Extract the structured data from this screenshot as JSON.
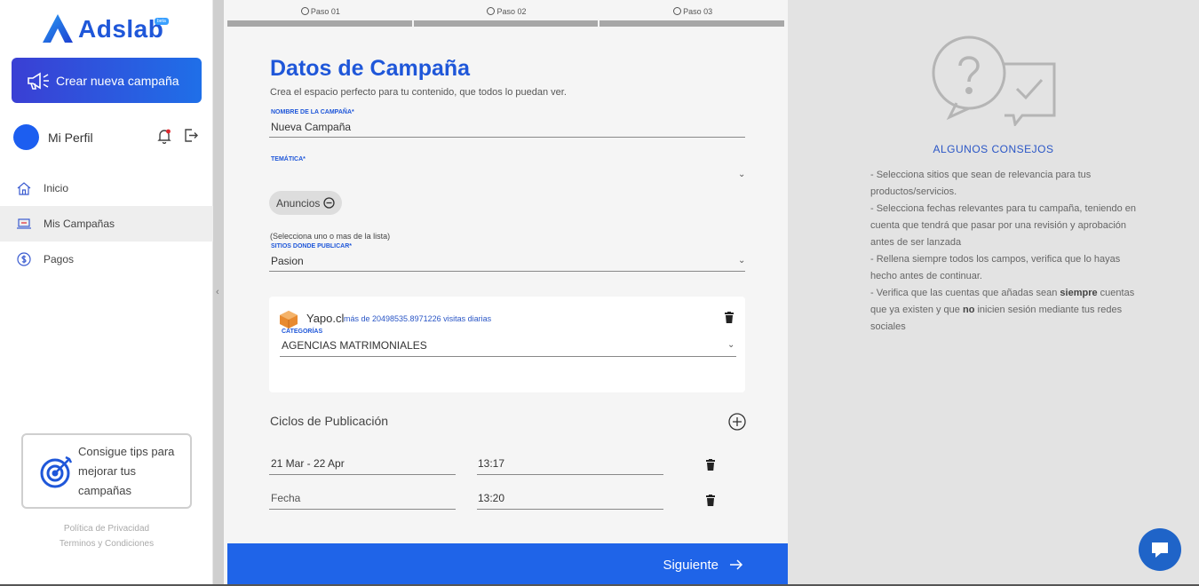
{
  "brand": {
    "name": "Adslab",
    "badge": "beta"
  },
  "sidebar": {
    "create_button": "Crear nueva campaña",
    "profile_name": "Mi Perfil",
    "nav": [
      {
        "label": "Inicio",
        "icon": "home-icon"
      },
      {
        "label": "Mis Campañas",
        "icon": "campaign-icon"
      },
      {
        "label": "Pagos",
        "icon": "dollar-icon"
      }
    ],
    "tips_card": "Consigue tips para mejorar tus campañas",
    "privacy": "Política de Privacidad",
    "terms": "Terminos y Condiciones"
  },
  "steps": [
    "Paso 01",
    "Paso 02",
    "Paso 03"
  ],
  "form": {
    "title": "Datos de Campaña",
    "subtitle": "Crea el espacio perfecto para tu contenido, que todos lo puedan ver.",
    "name_label": "NOMBRE DE LA CAMPAÑA*",
    "name_value": "Nueva Campaña",
    "theme_label": "TEMÁTICA*",
    "theme_value": "",
    "chip": "Anuncios",
    "hint": "(Selecciona uno o mas de la lista)",
    "sites_label": "SITIOS DONDE PUBLICAR*",
    "sites_value": "Pasion",
    "site_card": {
      "name": "Yapo.cl",
      "visits": "más de 20498535.8971226 visitas diarias",
      "category_label": "CATEGORÍAS",
      "category_value": "AGENCIAS MATRIMONIALES"
    },
    "cycles_title": "Ciclos de Publicación",
    "cycles": [
      {
        "date": "21 Mar - 22 Apr",
        "time": "13:17"
      },
      {
        "date": "Fecha",
        "time": "13:20"
      }
    ],
    "next_button": "Siguiente"
  },
  "tips": {
    "heading": "ALGUNOS CONSEJOS",
    "item1": "-   Selecciona sitios que sean de relevancia para tus productos/servicios.",
    "item2": "-   Selecciona fechas relevantes para tu campaña, teniendo en cuenta que tendrá que pasar por una revisión y aprobación antes de ser lanzada",
    "item3": "-   Rellena siempre todos los campos, verifica que lo hayas hecho antes de continuar.",
    "item4_a": "-   Verifica que las cuentas que añadas sean ",
    "item4_b": "siempre",
    "item4_c": " cuentas que ya existen y que ",
    "item4_d": "no",
    "item4_e": " inicien sesión mediante tus redes sociales"
  },
  "colors": {
    "accent": "#1f57d9",
    "button": "#1f64e8",
    "tips_bg": "#e3e3e3"
  }
}
